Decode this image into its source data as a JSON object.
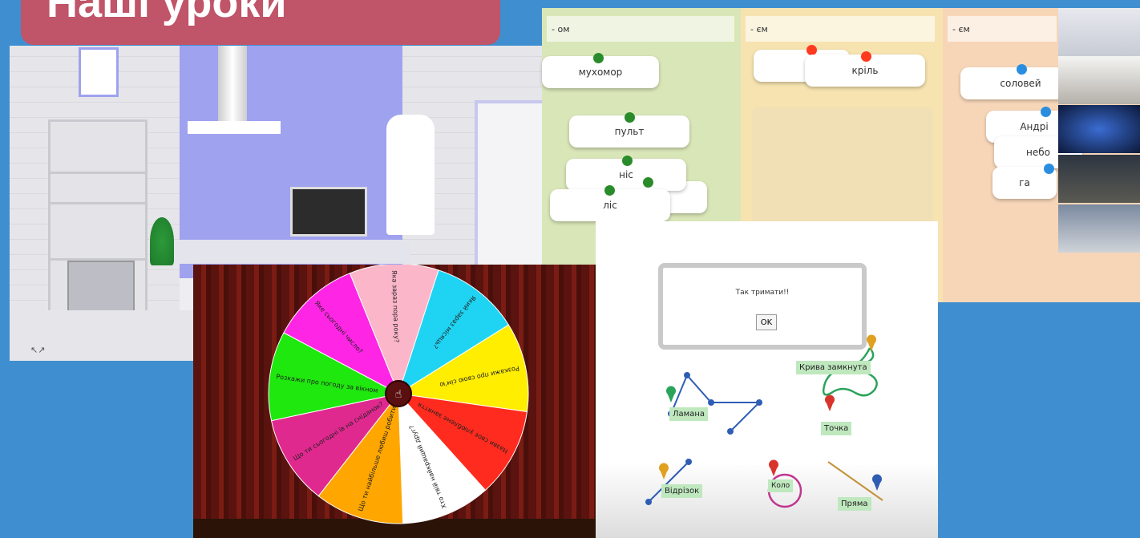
{
  "header": {
    "title": "Наші уроки"
  },
  "lab": {
    "expand_icon": "↖↗"
  },
  "wordboard": {
    "columns": [
      {
        "heading": "- ом",
        "color": "#d9e6b8"
      },
      {
        "heading": "- єм",
        "color": "#f6e3b0"
      },
      {
        "heading": "- єм",
        "color": "#f7d6b8"
      }
    ],
    "cards": [
      "мухомор",
      "пульт",
      "ніс",
      "ліс",
      "кріль",
      "соловей",
      "Андрі",
      "небо",
      "га"
    ]
  },
  "wheel": {
    "segments": [
      {
        "label": "Яка зараз пора року?",
        "color": "#fbb6c9"
      },
      {
        "label": "Який зараз місяць?",
        "color": "#1fd4f3"
      },
      {
        "label": "Розкажи про свою сім'ю",
        "color": "#ffee00"
      },
      {
        "label": "Назви своє улюблене заняття",
        "color": "#ff2b1e"
      },
      {
        "label": "Хто твій найкращий друг?",
        "color": "#ffffff"
      },
      {
        "label": "Що ти найбільше любиш робити?",
        "color": "#ffa600"
      },
      {
        "label": "Що ти сьогодні їв на сніданок?",
        "color": "#e0298f"
      },
      {
        "label": "Розкажи про погоду за вікном",
        "color": "#1ee80d"
      },
      {
        "label": "Яке сьогодні число?",
        "color": "#ff25e4"
      }
    ]
  },
  "geometry": {
    "dialog_message": "Так тримати!!",
    "ok_label": "OK",
    "labels": [
      "Крива замкнута",
      "Ламана",
      "Точка",
      "Відрізок",
      "Коло",
      "Пряма"
    ]
  }
}
